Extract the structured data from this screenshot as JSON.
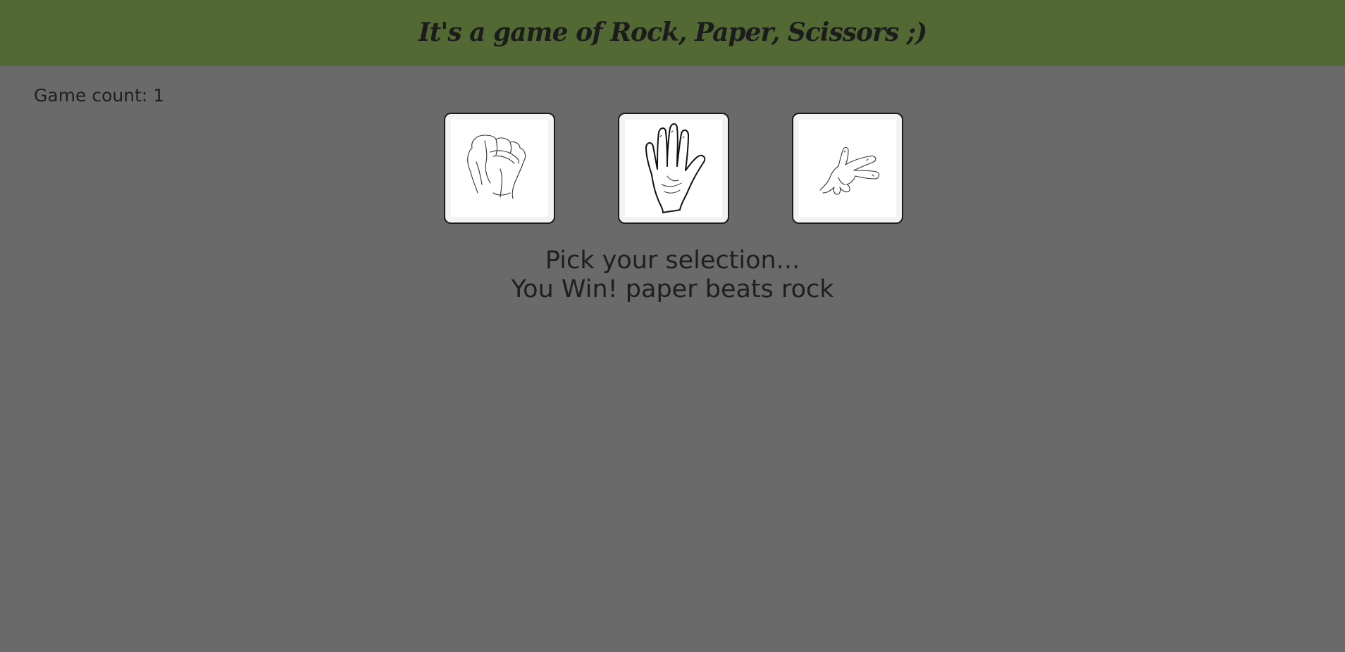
{
  "header": {
    "title": "It's a game of Rock, Paper, Scissors ;)",
    "background": "#526934"
  },
  "game": {
    "count_label": "Game count: 1"
  },
  "choices": [
    {
      "id": "rock",
      "icon": "rock-hand-icon"
    },
    {
      "id": "paper",
      "icon": "paper-hand-icon"
    },
    {
      "id": "scissors",
      "icon": "scissors-hand-icon"
    }
  ],
  "messages": {
    "prompt": "Pick your selection...",
    "result": "You Win! paper beats rock"
  },
  "colors": {
    "page_background": "#6a6a6a",
    "card_background": "#ffffff",
    "text": "#1f1f1f"
  }
}
